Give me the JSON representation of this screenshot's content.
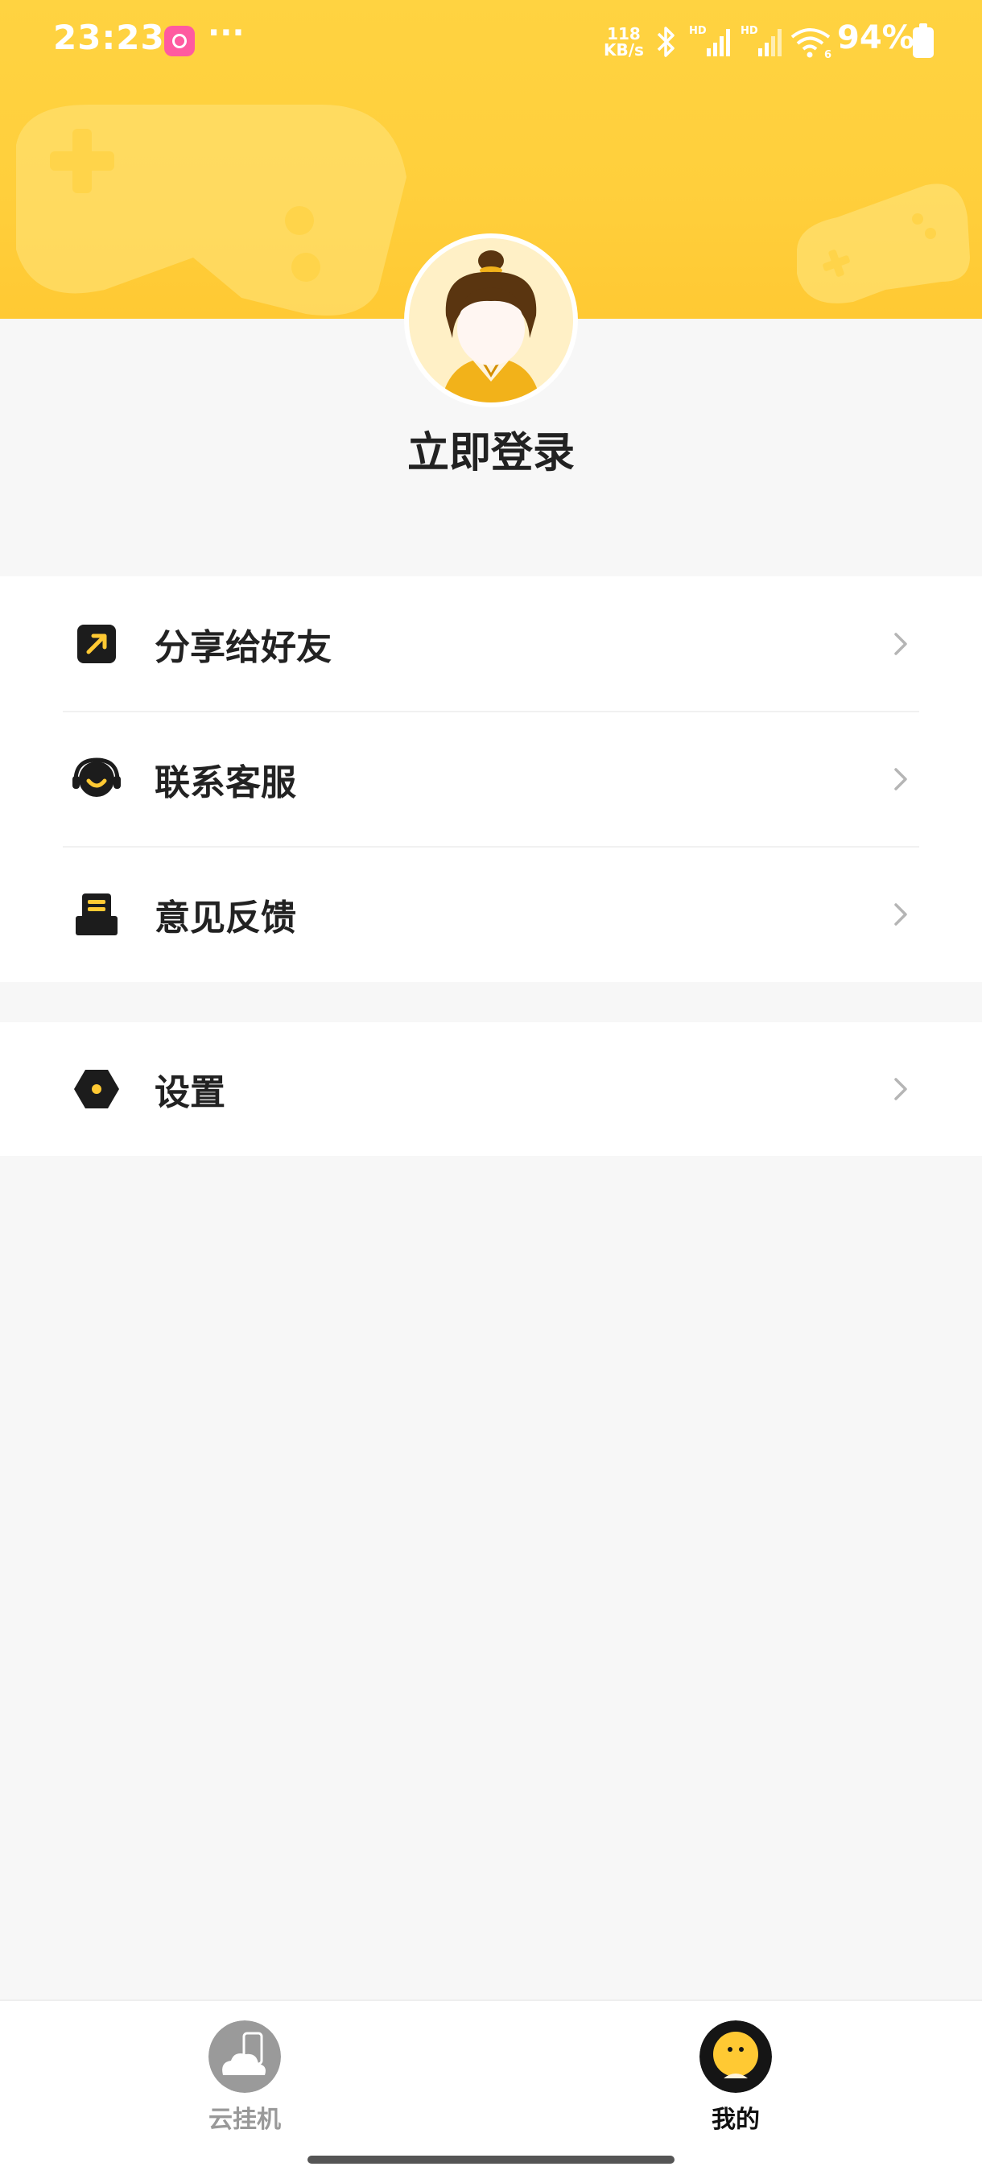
{
  "status_bar": {
    "time": "23:23",
    "more": "···",
    "speed_top": "118",
    "speed_bottom": "KB/s",
    "signal1_label": "HD",
    "signal2_label": "HD",
    "wifi_label": "6",
    "battery": "94%"
  },
  "profile": {
    "login_label": "立即登录"
  },
  "menu": {
    "share_label": "分享给好友",
    "support_label": "联系客服",
    "feedback_label": "意见反馈",
    "settings_label": "设置"
  },
  "tabbar": {
    "cloud_label": "云挂机",
    "mine_label": "我的",
    "active_tab": "我的"
  },
  "colors": {
    "banner": "#ffd341",
    "accent": "#ffc933",
    "text_primary": "#222222",
    "tab_inactive": "#999999",
    "tab_active": "#111111"
  },
  "icons": {
    "share": "share-arrow-icon",
    "support": "headset-icon",
    "feedback": "feedback-icon",
    "settings": "hexagon-settings-icon",
    "cloud_tab": "cloud-phone-icon",
    "mine_tab": "face-icon"
  }
}
